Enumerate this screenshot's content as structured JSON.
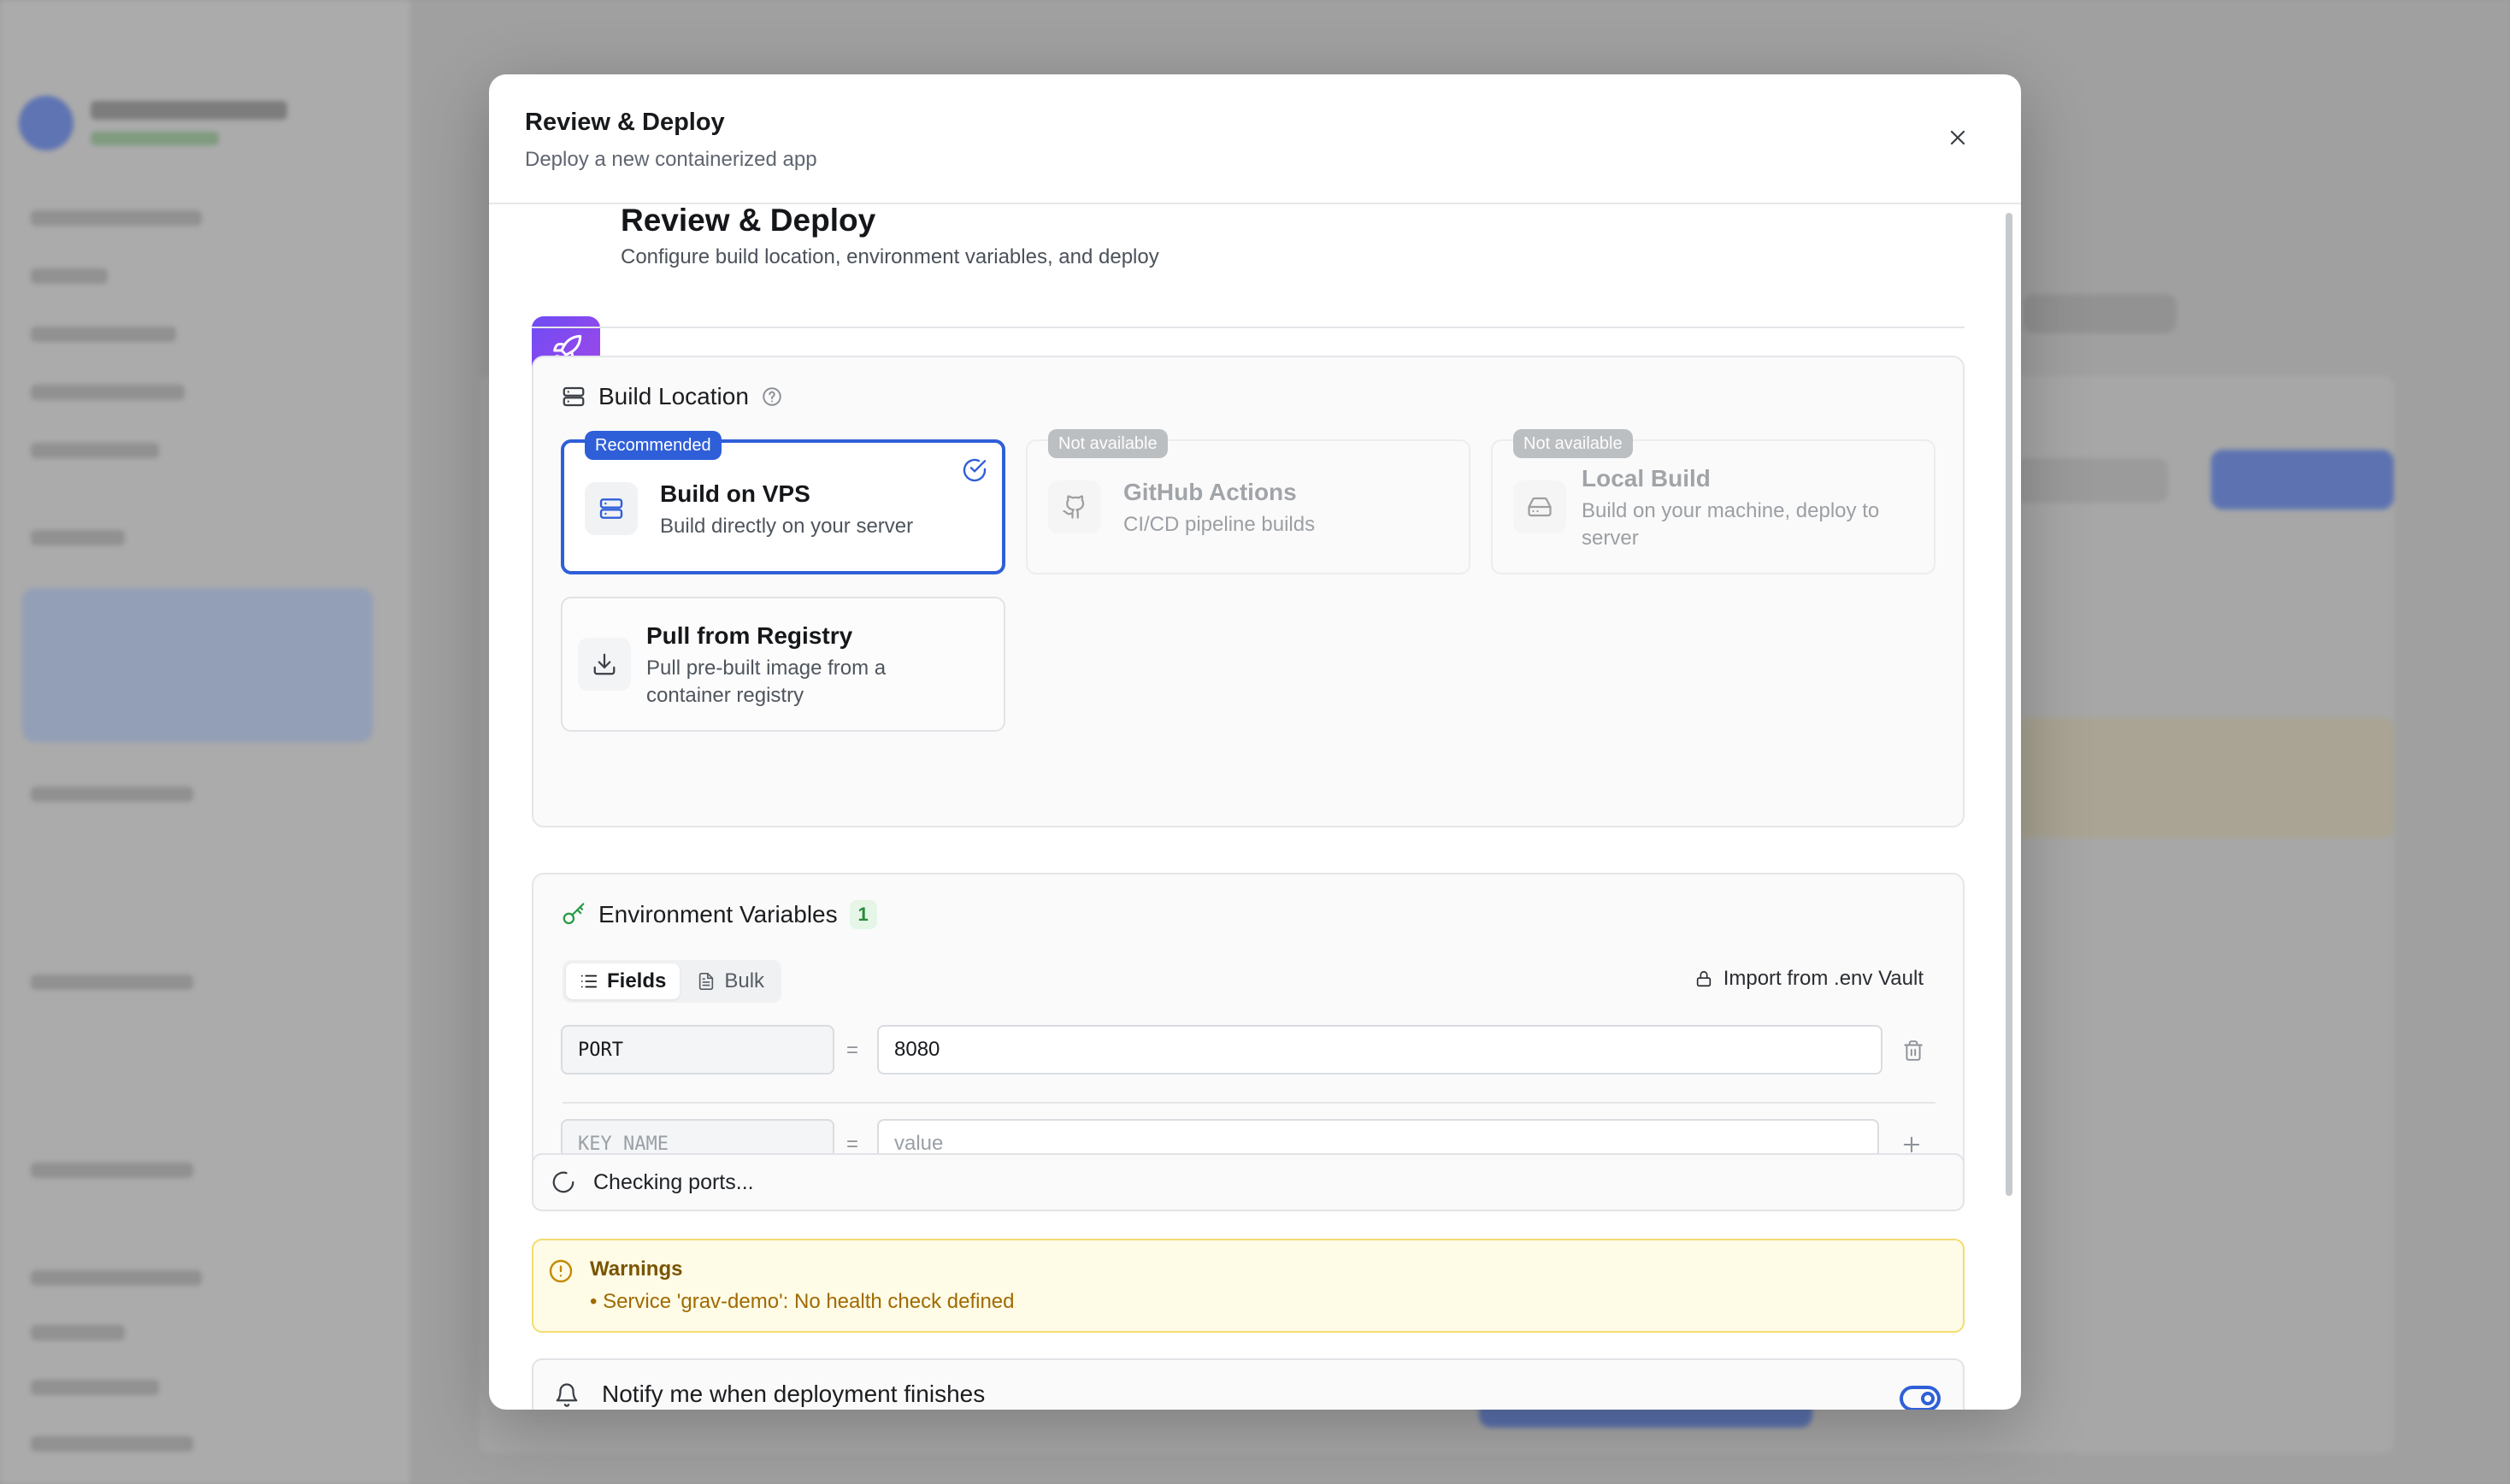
{
  "modal": {
    "title": "Review & Deploy",
    "subtitle": "Deploy a new containerized app"
  },
  "step": {
    "title": "Review & Deploy",
    "description": "Configure build location, environment variables, and deploy"
  },
  "build_location": {
    "heading": "Build Location",
    "options": [
      {
        "title": "Build on VPS",
        "description": "Build directly on your server",
        "badge": "Recommended",
        "selected": true,
        "icon": "server-icon"
      },
      {
        "title": "GitHub Actions",
        "description": "CI/CD pipeline builds",
        "badge": "Not available",
        "selected": false,
        "icon": "github-icon"
      },
      {
        "title": "Local Build",
        "description": "Build on your machine, deploy to server",
        "badge": "Not available",
        "selected": false,
        "icon": "hard-drive-icon"
      },
      {
        "title": "Pull from Registry",
        "description": "Pull pre-built image from a container registry",
        "badge": "",
        "selected": false,
        "icon": "download-icon"
      }
    ]
  },
  "env_vars": {
    "heading": "Environment Variables",
    "count": "1",
    "tabs": [
      {
        "label": "Fields",
        "active": true
      },
      {
        "label": "Bulk",
        "active": false
      }
    ],
    "import_label": "Import from .env Vault",
    "rows": [
      {
        "key": "PORT",
        "value": "8080"
      }
    ],
    "new_row": {
      "key_placeholder": "KEY_NAME",
      "value_placeholder": "value"
    },
    "equals": "="
  },
  "port_check": {
    "text": "Checking ports..."
  },
  "warnings": {
    "title": "Warnings",
    "items": [
      "• Service 'grav-demo': No health check defined"
    ]
  },
  "notify": {
    "label": "Notify me when deployment finishes",
    "enabled": true
  },
  "colors": {
    "accent": "#2f5fd8",
    "warning_bg": "#fefbe6",
    "warning_text": "#a06a00",
    "success": "#2a8a3a",
    "step_icon_gradient": [
      "#6e4cf5",
      "#a347e6"
    ]
  }
}
